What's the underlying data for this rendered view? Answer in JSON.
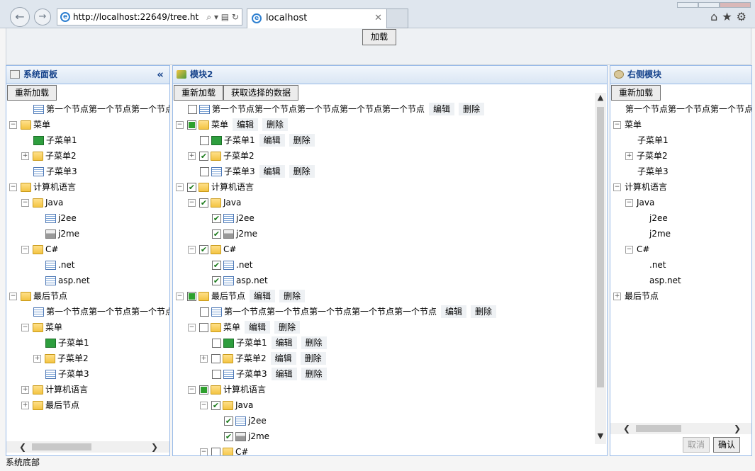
{
  "browser": {
    "url": "http://localhost:22649/tree.ht",
    "tab_title": "localhost",
    "url_tools": "⌕ ▾ ▤ ↻"
  },
  "top": {
    "load_label": "加载"
  },
  "left": {
    "title": "系统面板",
    "reload_label": "重新加载",
    "collapse": "«",
    "nodes": [
      {
        "t": "第一个节点第一个节点第一个节点第一个节点",
        "d": 1,
        "icon": "doc"
      },
      {
        "t": "菜单",
        "d": 0,
        "icon": "folder",
        "tw": "−"
      },
      {
        "t": "子菜单1",
        "d": 1,
        "icon": "save"
      },
      {
        "t": "子菜单2",
        "d": 1,
        "icon": "folder",
        "tw": "+"
      },
      {
        "t": "子菜单3",
        "d": 1,
        "icon": "doc"
      },
      {
        "t": "计算机语言",
        "d": 0,
        "icon": "folder",
        "tw": "−"
      },
      {
        "t": "Java",
        "d": 1,
        "icon": "folder",
        "tw": "−"
      },
      {
        "t": "j2ee",
        "d": 2,
        "icon": "doc"
      },
      {
        "t": "j2me",
        "d": 2,
        "icon": "printer"
      },
      {
        "t": "C#",
        "d": 1,
        "icon": "folder",
        "tw": "−"
      },
      {
        "t": ".net",
        "d": 2,
        "icon": "doc"
      },
      {
        "t": "asp.net",
        "d": 2,
        "icon": "doc"
      },
      {
        "t": "最后节点",
        "d": 0,
        "icon": "folder",
        "tw": "−"
      },
      {
        "t": "第一个节点第一个节点第一个节点第一个节点",
        "d": 1,
        "icon": "doc"
      },
      {
        "t": "菜单",
        "d": 1,
        "icon": "folder",
        "tw": "−"
      },
      {
        "t": "子菜单1",
        "d": 2,
        "icon": "save"
      },
      {
        "t": "子菜单2",
        "d": 2,
        "icon": "folder",
        "tw": "+"
      },
      {
        "t": "子菜单3",
        "d": 2,
        "icon": "doc"
      },
      {
        "t": "计算机语言",
        "d": 1,
        "icon": "folder",
        "tw": "+"
      },
      {
        "t": "最后节点",
        "d": 1,
        "icon": "folder",
        "tw": "+"
      }
    ]
  },
  "center": {
    "title": "模块2",
    "reload_label": "重新加载",
    "get_selected_label": "获取选择的数据",
    "edit_label": "编辑",
    "delete_label": "删除",
    "nodes": [
      {
        "t": "第一个节点第一个节点第一个节点第一个节点第一个节点",
        "d": 0,
        "icon": "doc",
        "cb": "none",
        "act": true,
        "leaf": true
      },
      {
        "t": "菜单",
        "d": 0,
        "icon": "folder",
        "cb": "partial",
        "tw": "−",
        "act": true
      },
      {
        "t": "子菜单1",
        "d": 1,
        "icon": "save",
        "cb": "none",
        "act": true
      },
      {
        "t": "子菜单2",
        "d": 1,
        "icon": "folder",
        "cb": "checked",
        "tw": "+"
      },
      {
        "t": "子菜单3",
        "d": 1,
        "icon": "doc",
        "cb": "none",
        "act": true
      },
      {
        "t": "计算机语言",
        "d": 0,
        "icon": "folder",
        "cb": "checked",
        "tw": "−"
      },
      {
        "t": "Java",
        "d": 1,
        "icon": "folder",
        "cb": "checked",
        "tw": "−"
      },
      {
        "t": "j2ee",
        "d": 2,
        "icon": "doc",
        "cb": "checked"
      },
      {
        "t": "j2me",
        "d": 2,
        "icon": "printer",
        "cb": "checked"
      },
      {
        "t": "C#",
        "d": 1,
        "icon": "folder",
        "cb": "checked",
        "tw": "−"
      },
      {
        "t": ".net",
        "d": 2,
        "icon": "doc",
        "cb": "checked"
      },
      {
        "t": "asp.net",
        "d": 2,
        "icon": "doc",
        "cb": "checked"
      },
      {
        "t": "最后节点",
        "d": 0,
        "icon": "folder",
        "cb": "partial",
        "tw": "−",
        "act": true
      },
      {
        "t": "第一个节点第一个节点第一个节点第一个节点第一个节点",
        "d": 1,
        "icon": "doc",
        "cb": "none",
        "act": true
      },
      {
        "t": "菜单",
        "d": 1,
        "icon": "folder",
        "cb": "none",
        "tw": "−",
        "act": true
      },
      {
        "t": "子菜单1",
        "d": 2,
        "icon": "save",
        "cb": "none",
        "act": true
      },
      {
        "t": "子菜单2",
        "d": 2,
        "icon": "folder",
        "cb": "none",
        "tw": "+",
        "act": true
      },
      {
        "t": "子菜单3",
        "d": 2,
        "icon": "doc",
        "cb": "none",
        "act": true
      },
      {
        "t": "计算机语言",
        "d": 1,
        "icon": "folder",
        "cb": "partial",
        "tw": "−"
      },
      {
        "t": "Java",
        "d": 2,
        "icon": "folder",
        "cb": "checked",
        "tw": "−"
      },
      {
        "t": "j2ee",
        "d": 3,
        "icon": "doc",
        "cb": "checked"
      },
      {
        "t": "j2me",
        "d": 3,
        "icon": "printer",
        "cb": "checked"
      },
      {
        "t": "C#",
        "d": 2,
        "icon": "folder",
        "cb": "none",
        "tw": "−"
      }
    ]
  },
  "right": {
    "title": "右侧模块",
    "reload_label": "重新加载",
    "cancel_label": "取消",
    "confirm_label": "确认",
    "nodes": [
      {
        "t": "第一个节点第一个节点第一个节点",
        "d": 0
      },
      {
        "t": "菜单",
        "d": 0,
        "tw": "−"
      },
      {
        "t": "子菜单1",
        "d": 1
      },
      {
        "t": "子菜单2",
        "d": 1,
        "tw": "+"
      },
      {
        "t": "子菜单3",
        "d": 1
      },
      {
        "t": "计算机语言",
        "d": 0,
        "tw": "−"
      },
      {
        "t": "Java",
        "d": 1,
        "tw": "−"
      },
      {
        "t": "j2ee",
        "d": 2
      },
      {
        "t": "j2me",
        "d": 2
      },
      {
        "t": "C#",
        "d": 1,
        "tw": "−"
      },
      {
        "t": ".net",
        "d": 2
      },
      {
        "t": "asp.net",
        "d": 2
      },
      {
        "t": "最后节点",
        "d": 0,
        "tw": "+"
      }
    ]
  },
  "footer": {
    "text": "系统底部"
  },
  "colors": {
    "panel_border": "#99bbe8",
    "check_green": "#2ea02e"
  }
}
